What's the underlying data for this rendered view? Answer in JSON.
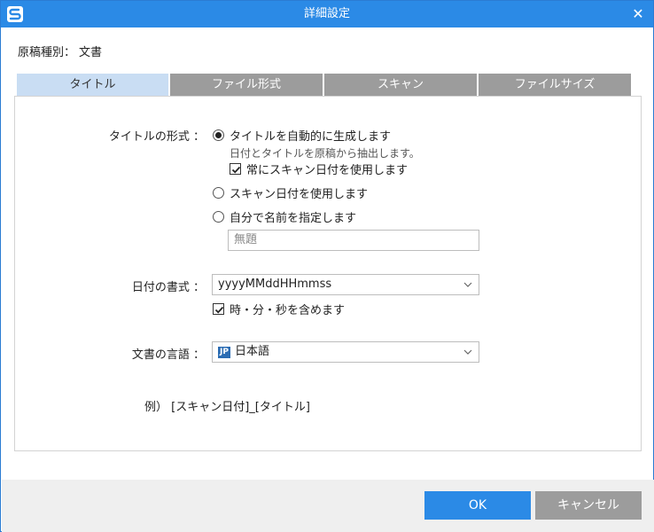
{
  "window": {
    "title": "詳細設定",
    "close_symbol": "✕"
  },
  "doc_type": {
    "label": "原稿種別：",
    "value": "文書"
  },
  "tabs": [
    {
      "label": "タイトル",
      "active": true
    },
    {
      "label": "ファイル形式",
      "active": false
    },
    {
      "label": "スキャン",
      "active": false
    },
    {
      "label": "ファイルサイズ",
      "active": false
    }
  ],
  "title_format": {
    "label": "タイトルの形式 ：",
    "options": [
      {
        "label": "タイトルを自動的に生成します",
        "selected": true
      },
      {
        "label": "スキャン日付を使用します",
        "selected": false
      },
      {
        "label": "自分で名前を指定します",
        "selected": false
      }
    ],
    "auto_hint": "日付とタイトルを原稿から抽出します。",
    "always_scan_date": {
      "label": "常にスキャン日付を使用します",
      "checked": true
    },
    "custom_name_placeholder": "無題"
  },
  "date_format": {
    "label": "日付の書式 ：",
    "value": "yyyyMMddHHmmss",
    "include_time": {
      "label": "時・分・秒を含めます",
      "checked": true
    }
  },
  "language": {
    "label": "文書の言語 ：",
    "badge": "JP",
    "value": "日本語"
  },
  "example": {
    "label": "例）",
    "value": "[スキャン日付]_[タイトル]"
  },
  "buttons": {
    "ok": "OK",
    "cancel": "キャンセル"
  },
  "colors": {
    "accent": "#2b8ae6",
    "tab_active": "#c9ddf3",
    "tab_inactive": "#9c9c9c"
  },
  "icons": {
    "app": "scansnap-app-icon",
    "close": "close-icon",
    "dropdown": "chevron-down-icon",
    "check": "check-icon"
  }
}
